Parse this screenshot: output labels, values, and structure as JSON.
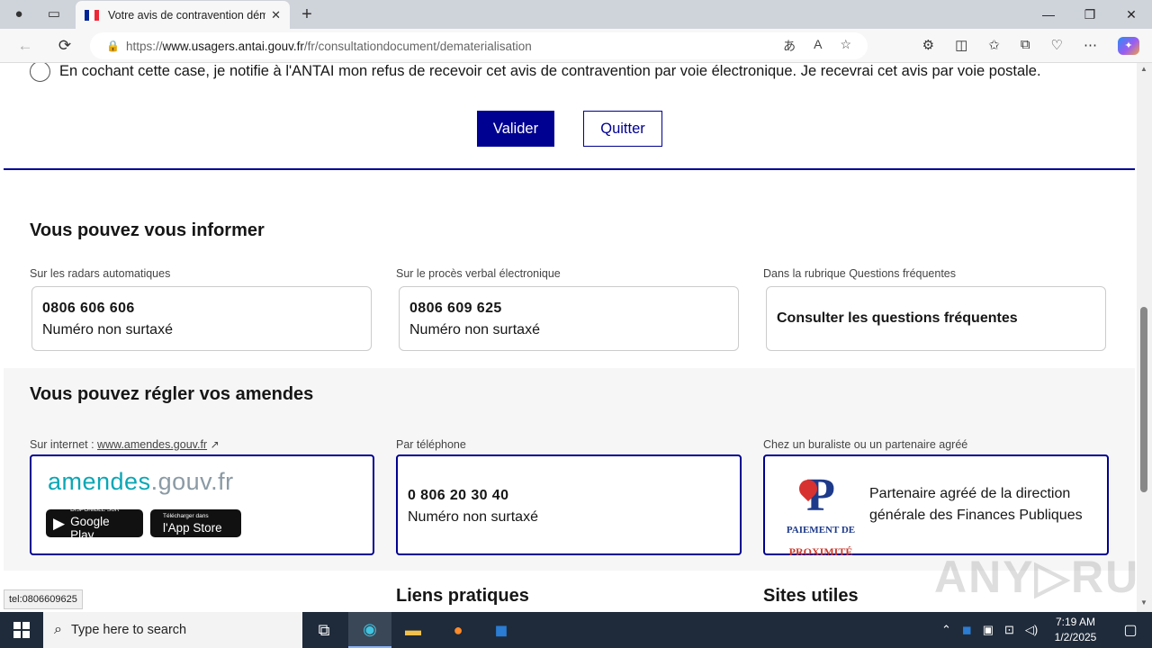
{
  "browser": {
    "tab": {
      "title": "Votre avis de contravention dématérialisé",
      "close": "✕"
    },
    "new_tab": "+",
    "window_controls": {
      "minimize": "—",
      "restore": "❐",
      "close": "✕"
    },
    "nav": {
      "back": "←",
      "reload": "⟳"
    },
    "address": {
      "url_prefix": "https://",
      "url_host": "www.usagers.antai.gouv.fr",
      "url_path": "/fr/consultationdocument/dematerialisation"
    }
  },
  "form": {
    "refusal_text": "En cochant cette case, je notifie à l'ANTAI mon refus de recevoir cet avis de contravention par voie électronique. Je recevrai cet avis par voie postale.",
    "refusal_checked": false,
    "validate_label": "Valider",
    "quit_label": "Quitter"
  },
  "inform": {
    "heading": "Vous pouvez vous informer",
    "cards": [
      {
        "caption": "Sur les radars automatiques",
        "number": "0806 606 606",
        "note": "Numéro non surtaxé"
      },
      {
        "caption": "Sur le procès verbal électronique",
        "number": "0806 609 625",
        "note": "Numéro non surtaxé"
      },
      {
        "caption": "Dans la rubrique Questions fréquentes",
        "link": "Consulter les questions fréquentes"
      }
    ]
  },
  "pay": {
    "heading": "Vous pouvez régler vos amendes",
    "internet": {
      "caption_prefix": "Sur internet : ",
      "caption_link": "www.amendes.gouv.fr",
      "logo_main": "amendes",
      "logo_suffix": ".gouv.fr",
      "google_small": "DISPONIBLE SUR",
      "google_big": "Google Play",
      "apple_small": "Télécharger dans",
      "apple_big": "l'App Store"
    },
    "phone": {
      "caption": "Par téléphone",
      "number": "0 806 20 30 40",
      "note": "Numéro non surtaxé"
    },
    "buraliste": {
      "caption": "Chez un buraliste ou un partenaire agréé",
      "logo_letter": "P",
      "logo_line1": "PAIEMENT DE",
      "logo_line2": "PROXIMITÉ",
      "text": "Partenaire agréé de la direction générale des Finances Publiques"
    }
  },
  "footer": {
    "links_heading": "Liens pratiques",
    "sites_heading": "Sites utiles"
  },
  "status_tooltip": "tel:0806609625",
  "watermark": "ANY▷RUN",
  "taskbar": {
    "search_placeholder": "Type here to search",
    "time": "7:19 AM",
    "date": "1/2/2025"
  },
  "colors": {
    "primary": "#000091",
    "logo_teal": "#0aa7b5",
    "taskbar": "#1f2b3a"
  }
}
